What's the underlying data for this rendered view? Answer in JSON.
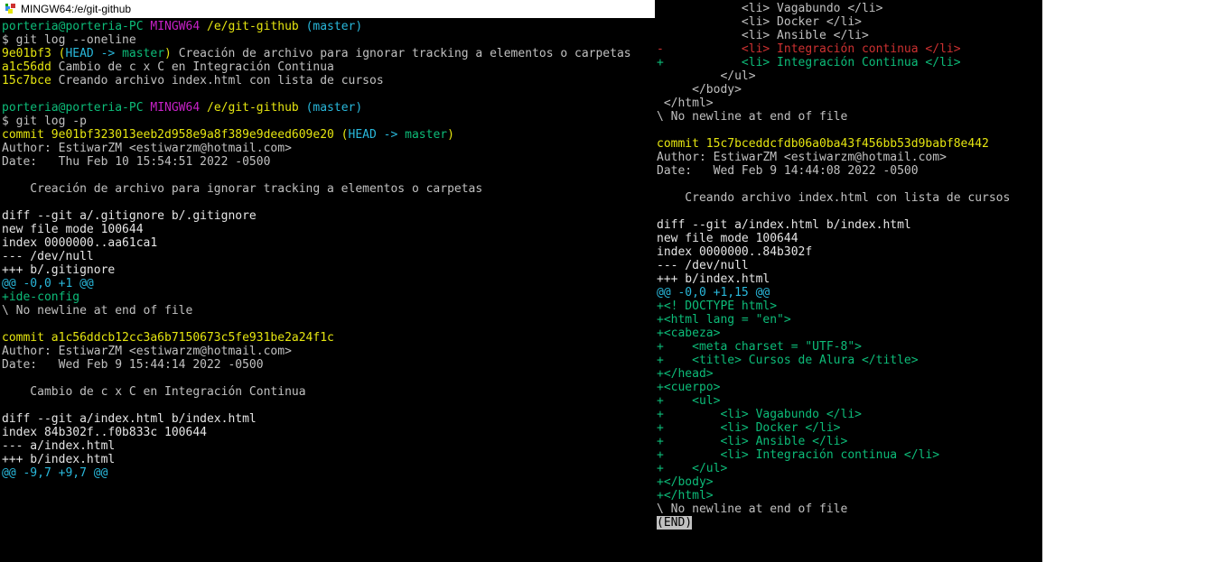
{
  "titleBar": {
    "text": "MINGW64:/e/git-github"
  },
  "leftPrompt1": {
    "user": "porteria@porteria-PC",
    "sys": "MINGW64",
    "path": "/e/git-github",
    "branch": "(master)"
  },
  "leftCmd1": "$ git log --oneline",
  "leftOneline": {
    "l1hash": "9e01bf3",
    "l1branch": "(",
    "l1head": "HEAD -> ",
    "l1master": "master",
    "l1close": ")",
    "l1msg": " Creación de archivo para ignorar tracking a elementos o carpetas",
    "l2hash": "a1c56dd",
    "l2msg": " Cambio de c x C en Integración Continua",
    "l3hash": "15c7bce",
    "l3msg": " Creando archivo index.html con lista de cursos"
  },
  "leftPrompt2": {
    "user": "porteria@porteria-PC",
    "sys": "MINGW64",
    "path": "/e/git-github",
    "branch": "(master)"
  },
  "leftCmd2": "$ git log -p",
  "commit1": {
    "line": "commit 9e01bf323013eeb2d958e9a8f389e9deed609e20 (",
    "head": "HEAD -> ",
    "master": "master",
    "close": ")",
    "author": "Author: EstiwarZM <estiwarzm@hotmail.com>",
    "date": "Date:   Thu Feb 10 15:54:51 2022 -0500",
    "msg": "    Creación de archivo para ignorar tracking a elementos o carpetas"
  },
  "diff1": {
    "header": "diff --git a/.gitignore b/.gitignore",
    "newfile": "new file mode 100644",
    "index": "index 0000000..aa61ca1",
    "minus": "--- /dev/null",
    "plus": "+++ b/.gitignore",
    "hunk": "@@ -0,0 +1 @@",
    "add1": "+ide-config",
    "nonewline": "\\ No newline at end of file"
  },
  "commit2": {
    "line": "commit a1c56ddcb12cc3a6b7150673c5fe931be2a24f1c",
    "author": "Author: EstiwarZM <estiwarzm@hotmail.com>",
    "date": "Date:   Wed Feb 9 15:44:14 2022 -0500",
    "msg": "    Cambio de c x C en Integración Continua"
  },
  "diff2": {
    "header": "diff --git a/index.html b/index.html",
    "index": "index 84b302f..f0b833c 100644",
    "minus": "--- a/index.html",
    "plus": "+++ b/index.html",
    "hunk": "@@ -9,7 +9,7 @@"
  },
  "right": {
    "l1": "            <li> Vagabundo </li>",
    "l2": "            <li> Docker </li>",
    "l3": "            <li> Ansible </li>",
    "del": "-           <li> Integración continua </li>",
    "add": "+           <li> Integración Continua </li>",
    "l4": "         </ul>",
    "l5": "     </body>",
    "l6": " </html>",
    "nonewline1": "\\ No newline at end of file"
  },
  "commit3": {
    "line": "commit 15c7bceddcfdb06a0ba43f456bb53d9babf8e442",
    "author": "Author: EstiwarZM <estiwarzm@hotmail.com>",
    "date": "Date:   Wed Feb 9 14:44:08 2022 -0500",
    "msg": "    Creando archivo index.html con lista de cursos"
  },
  "diff3": {
    "header": "diff --git a/index.html b/index.html",
    "newfile": "new file mode 100644",
    "index": "index 0000000..84b302f",
    "minus": "--- /dev/null",
    "plus": "+++ b/index.html",
    "hunk": "@@ -0,0 +1,15 @@",
    "a1": "+<! DOCTYPE html>",
    "a2": "+<html lang = \"en\">",
    "a3": "+<cabeza>",
    "a4": "+    <meta charset = \"UTF-8\">",
    "a5": "+    <title> Cursos de Alura </title>",
    "a6": "+</head>",
    "a7": "+<cuerpo>",
    "a8": "+    <ul>",
    "a9": "+        <li> Vagabundo </li>",
    "a10": "+        <li> Docker </li>",
    "a11": "+        <li> Ansible </li>",
    "a12": "+        <li> Integración continua </li>",
    "a13": "+    </ul>",
    "a14": "+</body>",
    "a15": "+</html>",
    "nonewline": "\\ No newline at end of file"
  },
  "end": "(END)"
}
